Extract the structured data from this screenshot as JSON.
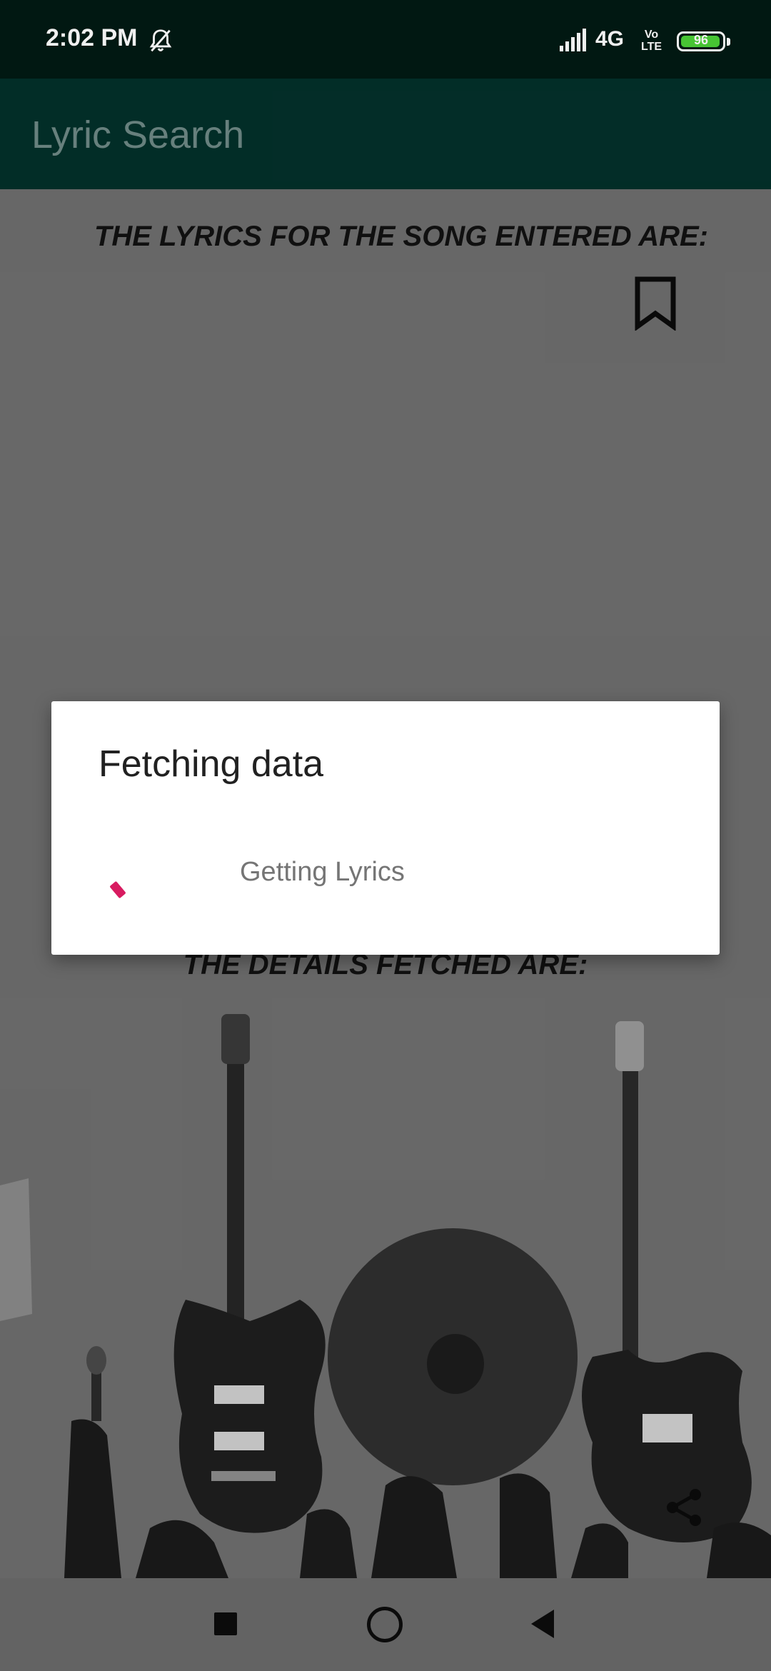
{
  "status_bar": {
    "time": "2:02 PM",
    "network": "4G",
    "volte_top": "Vo",
    "volte_bottom": "LTE",
    "battery": "96",
    "battery_color": "#4cd137",
    "icons": [
      "muted-bell-icon",
      "signal-icon",
      "battery-icon"
    ]
  },
  "app_bar": {
    "title": "Lyric Search"
  },
  "main": {
    "lyrics_heading": "THE LYRICS FOR THE SONG ENTERED ARE:",
    "details_heading": "THE DETAILS FETCHED ARE:",
    "icons": [
      "bookmark-icon",
      "share-icon"
    ]
  },
  "dialog": {
    "title": "Fetching data",
    "message": "Getting Lyrics",
    "spinner_color": "#d81b60"
  },
  "nav_bar": {
    "icons": [
      "recents-icon",
      "home-icon",
      "back-icon"
    ]
  }
}
